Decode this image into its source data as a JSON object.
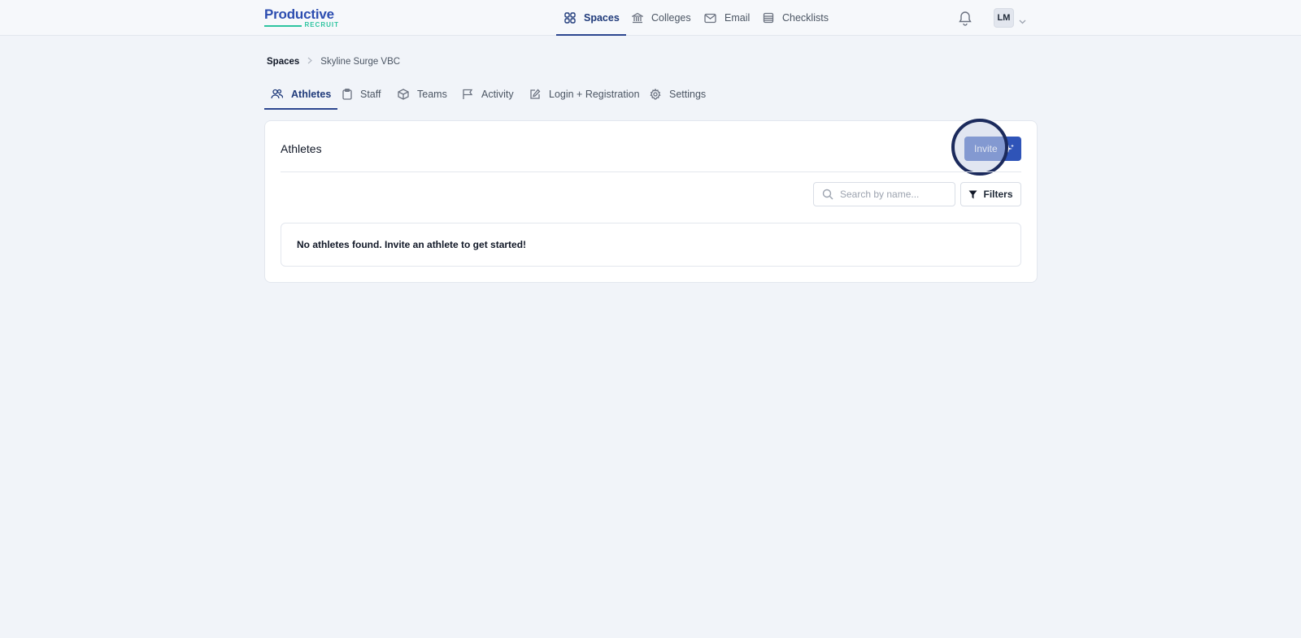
{
  "brand": {
    "name": "Productive",
    "tagline": "RECRUIT",
    "primary_color": "#2c4db0",
    "accent_color": "#2ec4a0"
  },
  "topnav": {
    "items": [
      {
        "label": "Spaces",
        "icon": "grid-icon",
        "active": true
      },
      {
        "label": "Colleges",
        "icon": "bank-icon",
        "active": false
      },
      {
        "label": "Email",
        "icon": "mail-icon",
        "active": false
      },
      {
        "label": "Checklists",
        "icon": "list-icon",
        "active": false
      }
    ],
    "notifications_icon": "bell-icon",
    "user_initials": "LM"
  },
  "breadcrumb": {
    "root": "Spaces",
    "current": "Skyline Surge VBC"
  },
  "tabs": [
    {
      "label": "Athletes",
      "icon": "users-icon",
      "active": true
    },
    {
      "label": "Staff",
      "icon": "clipboard-icon",
      "active": false
    },
    {
      "label": "Teams",
      "icon": "cube-icon",
      "active": false
    },
    {
      "label": "Activity",
      "icon": "flag-icon",
      "active": false
    },
    {
      "label": "Login + Registration",
      "icon": "edit-icon",
      "active": false
    },
    {
      "label": "Settings",
      "icon": "gear-icon",
      "active": false
    }
  ],
  "card": {
    "title": "Athletes",
    "invite_label": "Invite",
    "search_placeholder": "Search by name...",
    "filters_label": "Filters",
    "empty_message": "No athletes found. Invite an athlete to get started!"
  }
}
